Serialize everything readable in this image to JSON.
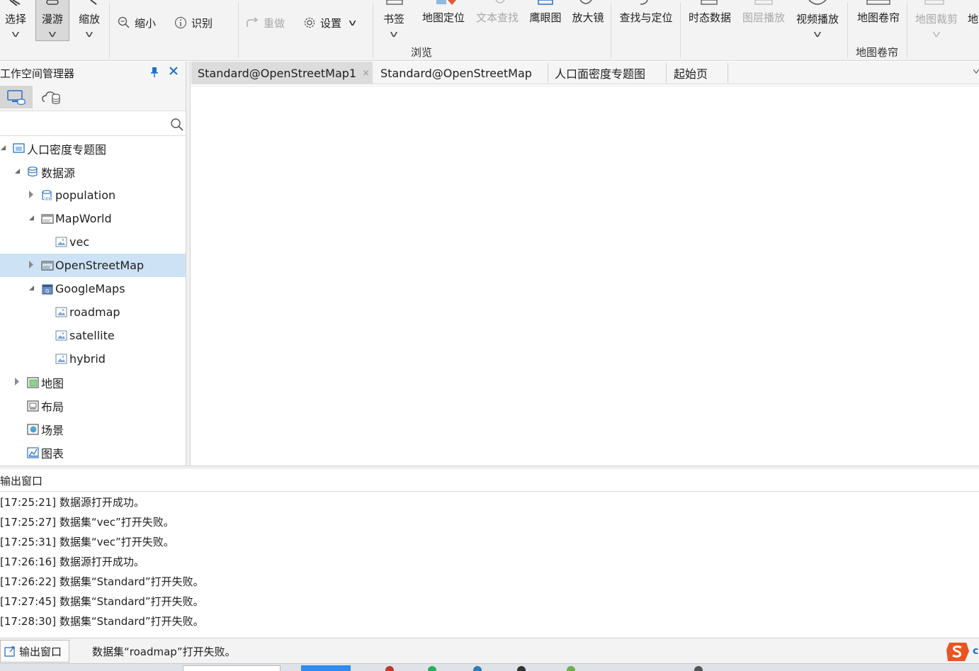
{
  "ribbon": {
    "select_label": "选择",
    "pan_label": "漫游",
    "zoom_label": "缩放",
    "zoom_out_label": "缩小",
    "identify_label": "识别",
    "redo_label": "重做",
    "settings_label": "设置",
    "bookmark_label": "书签",
    "map_locate_label": "地图定位",
    "text_search_label": "文本查找",
    "overview_label": "鹰眼图",
    "magnifier_label": "放大镜",
    "find_locate_label": "查找与定位",
    "temporal_label": "时态数据",
    "layer_play_label": "图层播放",
    "video_play_label": "视频播放",
    "browse_group_label": "浏览",
    "map_swipe_label": "地图卷帘",
    "map_swipe_group_label": "地图卷帘",
    "map_clip_label": "地图裁剪",
    "map_more_label": "地"
  },
  "workspace": {
    "title": "工作空间管理器",
    "search_placeholder": "",
    "tree": [
      {
        "label": "人口密度专题图",
        "level": 0,
        "expanded": true,
        "icon": "workspace-icon"
      },
      {
        "label": "数据源",
        "level": 1,
        "expanded": true,
        "icon": "datasources-icon"
      },
      {
        "label": "population",
        "level": 2,
        "expanded": false,
        "icon": "udb-datasource-icon"
      },
      {
        "label": "MapWorld",
        "level": 2,
        "expanded": true,
        "icon": "web-datasource-icon"
      },
      {
        "label": "vec",
        "level": 3,
        "icon": "image-dataset-icon"
      },
      {
        "label": "OpenStreetMap",
        "level": 2,
        "expanded": false,
        "selected": true,
        "icon": "web-datasource-icon"
      },
      {
        "label": "GoogleMaps",
        "level": 2,
        "expanded": true,
        "icon": "google-datasource-icon"
      },
      {
        "label": "roadmap",
        "level": 3,
        "icon": "image-dataset-icon"
      },
      {
        "label": "satellite",
        "level": 3,
        "icon": "image-dataset-icon"
      },
      {
        "label": "hybrid",
        "level": 3,
        "icon": "image-dataset-icon"
      },
      {
        "label": "地图",
        "level": 1,
        "expanded": false,
        "icon": "maps-icon"
      },
      {
        "label": "布局",
        "level": 1,
        "icon": "layouts-icon"
      },
      {
        "label": "场景",
        "level": 1,
        "icon": "scenes-icon"
      },
      {
        "label": "图表",
        "level": 1,
        "icon": "charts-icon"
      }
    ]
  },
  "doc_tabs": [
    {
      "label": "Standard@OpenStreetMap1",
      "active": true,
      "close": "×"
    },
    {
      "label": "Standard@OpenStreetMap"
    },
    {
      "label": "人口面密度专题图"
    },
    {
      "label": "起始页"
    }
  ],
  "output": {
    "title": "输出窗口",
    "lines": [
      "[17:25:21] 数据源打开成功。",
      "[17:25:27] 数据集“vec”打开失败。",
      "[17:25:31] 数据集“vec”打开失败。",
      "[17:26:16] 数据源打开成功。",
      "[17:26:22] 数据集“Standard”打开失败。",
      "[17:27:45] 数据集“Standard”打开失败。",
      "[17:28:30] 数据集“Standard”打开失败。"
    ]
  },
  "status": {
    "tab_label": "输出窗口",
    "message": "数据集“roadmap”打开失败。"
  },
  "colors": {
    "accent": "#1e6fd0",
    "selection": "#cde2f5",
    "ribbon_bg": "#f3f3f3",
    "disabled_text": "#a8a8a8"
  }
}
